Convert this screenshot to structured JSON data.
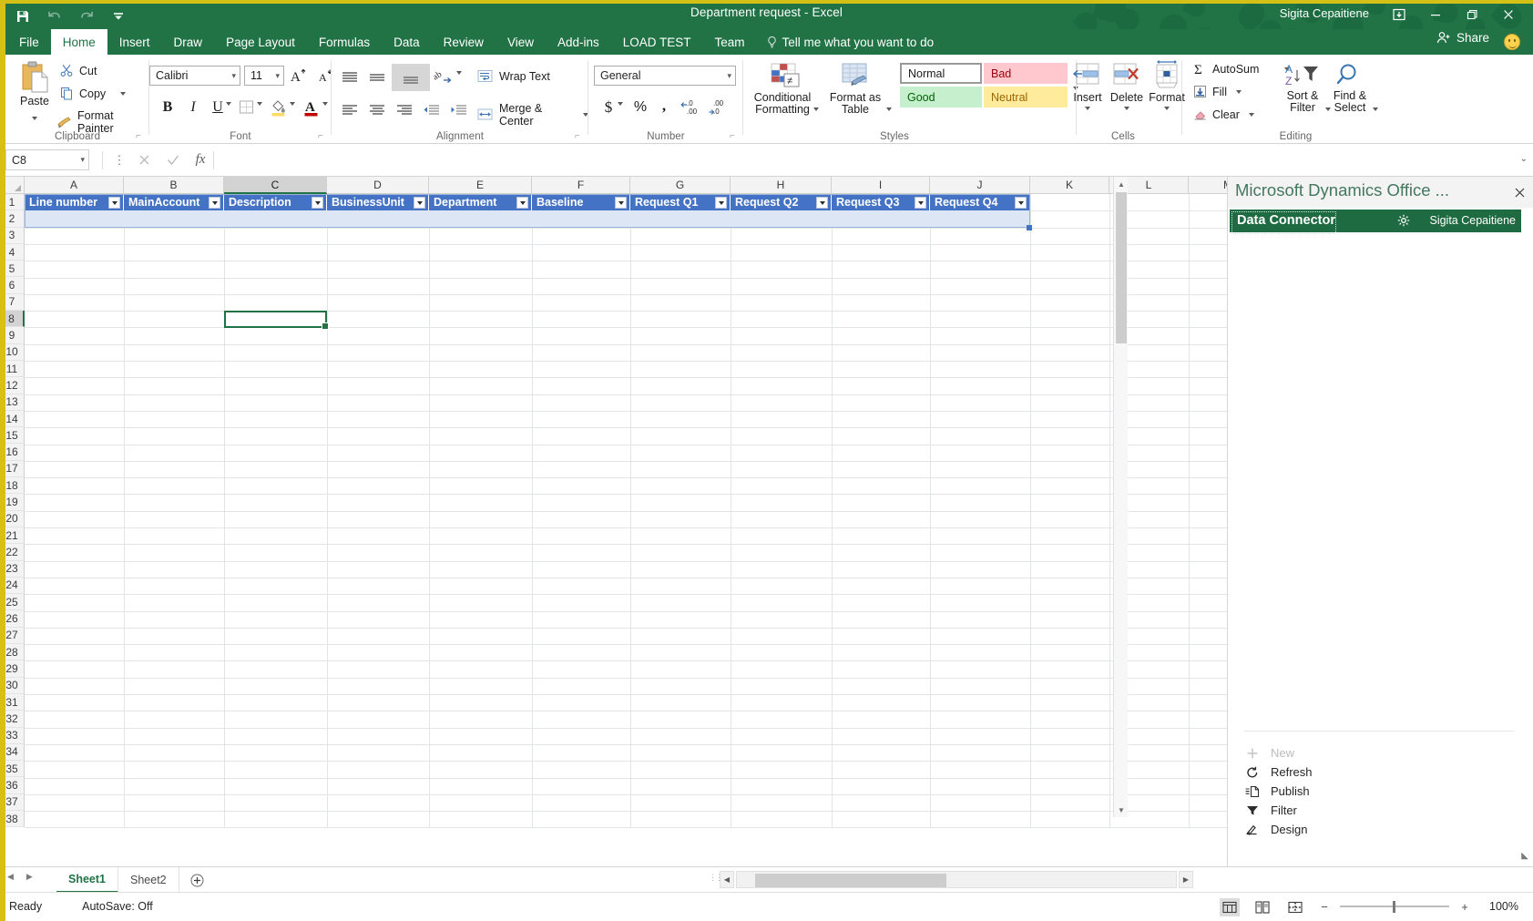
{
  "titlebar": {
    "document_title": "Department request  -  Excel",
    "account_name": "Sigita Cepaitiene",
    "quick_access": [
      {
        "name": "save-icon",
        "label": "Save"
      },
      {
        "name": "undo-icon",
        "label": "Undo"
      },
      {
        "name": "redo-icon",
        "label": "Redo"
      },
      {
        "name": "customize-qat-icon",
        "label": "Customize Quick Access Toolbar"
      }
    ],
    "window_controls": [
      {
        "name": "ribbon-display-options-icon",
        "label": "Ribbon Display Options"
      },
      {
        "name": "minimize-icon",
        "label": "Minimize"
      },
      {
        "name": "restore-icon",
        "label": "Restore Down"
      },
      {
        "name": "close-icon",
        "label": "Close"
      }
    ]
  },
  "ribbon_tabs": [
    {
      "label": "File",
      "active": false
    },
    {
      "label": "Home",
      "active": true
    },
    {
      "label": "Insert",
      "active": false
    },
    {
      "label": "Draw",
      "active": false
    },
    {
      "label": "Page Layout",
      "active": false
    },
    {
      "label": "Formulas",
      "active": false
    },
    {
      "label": "Data",
      "active": false
    },
    {
      "label": "Review",
      "active": false
    },
    {
      "label": "View",
      "active": false
    },
    {
      "label": "Add-ins",
      "active": false
    },
    {
      "label": "LOAD TEST",
      "active": false
    },
    {
      "label": "Team",
      "active": false
    }
  ],
  "tell_me": "Tell me what you want to do",
  "share_label": "Share",
  "ribbon": {
    "clipboard": {
      "group_label": "Clipboard",
      "paste": "Paste",
      "cut": "Cut",
      "copy": "Copy",
      "format_painter": "Format Painter"
    },
    "font": {
      "group_label": "Font",
      "font_name": "Calibri",
      "font_size": "11",
      "increase_size": "A",
      "decrease_size": "A",
      "bold": "B",
      "italic": "I",
      "underline": "U"
    },
    "alignment": {
      "group_label": "Alignment",
      "wrap_text": "Wrap Text",
      "merge_center": "Merge & Center"
    },
    "number": {
      "group_label": "Number",
      "format": "General",
      "currency": "$",
      "percent": "%",
      "comma": ",",
      "increase_decimal": ".00",
      "decrease_decimal": ".00"
    },
    "styles": {
      "group_label": "Styles",
      "conditional_formatting": "Conditional\nFormatting",
      "conditional_formatting_l1": "Conditional",
      "conditional_formatting_l2": "Formatting",
      "format_as_table_l1": "Format as",
      "format_as_table_l2": "Table",
      "gallery": [
        {
          "label": "Normal",
          "bg": "#ffffff",
          "fg": "#1d1d1d",
          "selected": true
        },
        {
          "label": "Bad",
          "bg": "#ffc7ce",
          "fg": "#9c0006",
          "selected": false
        },
        {
          "label": "Good",
          "bg": "#c6efce",
          "fg": "#006100",
          "selected": false
        },
        {
          "label": "Neutral",
          "bg": "#ffeb9c",
          "fg": "#9c6500",
          "selected": false
        }
      ]
    },
    "cells": {
      "group_label": "Cells",
      "insert": "Insert",
      "delete": "Delete",
      "format": "Format"
    },
    "editing": {
      "group_label": "Editing",
      "autosum": "AutoSum",
      "fill": "Fill",
      "clear": "Clear",
      "sort_filter_l1": "Sort &",
      "sort_filter_l2": "Filter",
      "find_select_l1": "Find &",
      "find_select_l2": "Select"
    }
  },
  "formula_bar": {
    "name_box": "C8",
    "formula_value": "",
    "cancel_icon": "cancel-icon",
    "enter_icon": "enter-icon",
    "function_icon": "fx"
  },
  "grid": {
    "column_headers": [
      "A",
      "B",
      "C",
      "D",
      "E",
      "F",
      "G",
      "H",
      "I",
      "J",
      "K",
      "L",
      "M"
    ],
    "active_column": "C",
    "active_row": 8,
    "row_numbers": [
      1,
      2,
      3,
      4,
      5,
      6,
      7,
      8,
      9,
      10,
      11,
      12,
      13,
      14,
      15,
      16,
      17,
      18,
      19,
      20,
      21,
      22,
      23,
      24,
      25,
      26,
      27,
      28,
      29,
      30,
      31,
      32,
      33,
      34,
      35,
      36,
      37,
      38
    ],
    "table_headers": [
      "Line number",
      "MainAccount",
      "Description",
      "BusinessUnit",
      "Department",
      "Baseline",
      "Request Q1",
      "Request Q2",
      "Request Q3",
      "Request Q4"
    ],
    "header_fill": "#4472c4",
    "row2_fill": "#dce6f4"
  },
  "task_pane": {
    "title": "Microsoft Dynamics Office ...",
    "connector_title": "Data Connector",
    "user": "Sigita Cepaitiene",
    "gear_icon": "gear-icon",
    "close_icon": "close-icon",
    "actions": [
      {
        "label": "New",
        "icon": "plus-icon",
        "disabled": true
      },
      {
        "label": "Refresh",
        "icon": "refresh-icon",
        "disabled": false
      },
      {
        "label": "Publish",
        "icon": "publish-icon",
        "disabled": false
      },
      {
        "label": "Filter",
        "icon": "filter-icon",
        "disabled": false
      },
      {
        "label": "Design",
        "icon": "design-icon",
        "disabled": false
      }
    ]
  },
  "sheet_tabs": {
    "tabs": [
      {
        "label": "Sheet1",
        "active": true
      },
      {
        "label": "Sheet2",
        "active": false
      }
    ],
    "add_sheet": "+"
  },
  "status_bar": {
    "ready": "Ready",
    "autosave": "AutoSave: Off",
    "zoom": "100%",
    "views": [
      {
        "name": "normal-view-icon",
        "label": "Normal",
        "selected": true
      },
      {
        "name": "page-layout-view-icon",
        "label": "Page Layout",
        "selected": false
      },
      {
        "name": "page-break-view-icon",
        "label": "Page Break Preview",
        "selected": false
      }
    ]
  },
  "colors": {
    "excel_green": "#217346",
    "accent_yellow": "#d4c017",
    "table_blue": "#4472c4"
  }
}
